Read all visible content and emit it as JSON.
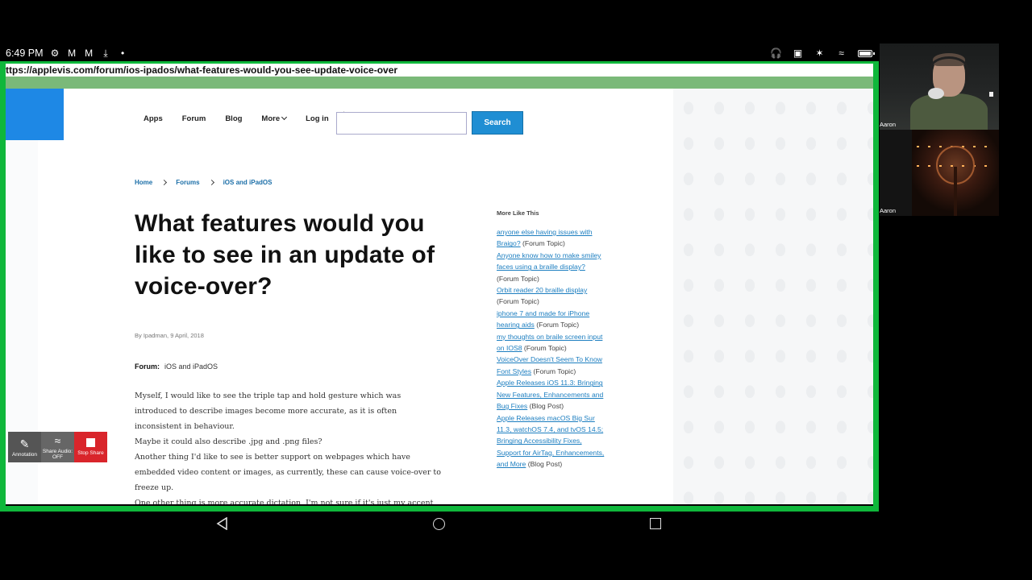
{
  "status_bar": {
    "time": "6:49 PM",
    "left_icons": [
      "gear-icon",
      "gmail-icon",
      "gmail-icon",
      "download-icon",
      "dot-icon"
    ],
    "right_icons": [
      "headphones-icon",
      "cast-icon",
      "bluetooth-icon",
      "wifi-icon",
      "battery-icon"
    ]
  },
  "browser": {
    "url": "ttps://applevis.com/forum/ios-ipados/what-features-would-you-see-update-voice-over"
  },
  "site_nav": {
    "items": [
      "Apps",
      "Forum",
      "Blog",
      "More",
      "Log in"
    ],
    "search_placeholder": "",
    "search_button": "Search"
  },
  "breadcrumb": [
    "Home",
    "Forums",
    "iOS and iPadOS"
  ],
  "article": {
    "title": "What features would you like to see in an update of voice-over?",
    "byline": "By Ipadman, 9 April, 2018",
    "forum_label": "Forum:",
    "forum_value": "iOS and iPadOS",
    "paragraphs": [
      "Myself, I would like to see the triple tap and hold gesture which was introduced to describe images become more accurate, as it is often inconsistent in behaviour.",
      "Maybe it could also describe .jpg and .png files?",
      "Another thing I'd like to see is better support on webpages which have embedded video content or images, as currently, these can cause voice-over to freeze up.",
      "One other thing is more accurate dictation, I'm not sure if it's just my accent but dictation doesn't seem to get most of my words right, or misses out some words entirely."
    ]
  },
  "sidebar": {
    "heading": "More Like This",
    "items": [
      {
        "link": "anyone else having issues with Braigo?",
        "type": "(Forum Topic)"
      },
      {
        "link": "Anyone know how to make smiley faces using a braille display?",
        "type": "(Forum Topic)"
      },
      {
        "link": "Orbit reader 20 braille display",
        "type": "(Forum Topic)"
      },
      {
        "link": "iphone 7 and made for iPhone hearing aids",
        "type": "(Forum Topic)"
      },
      {
        "link": "my thoughts on braile screen input on IOS8",
        "type": "(Forum Topic)"
      },
      {
        "link": "VoiceOver Doesn't Seem To Know Font Styles",
        "type": "(Forum Topic)"
      },
      {
        "link": "Apple Releases iOS 11.3: Bringing New Features, Enhancements and Bug Fixes",
        "type": "(Blog Post)"
      },
      {
        "link": "Apple Releases macOS Big Sur 11.3, watchOS 7.4, and tvOS 14.5; Bringing Accessibility Fixes, Support for AirTag, Enhancements, and More",
        "type": "(Blog Post)"
      }
    ]
  },
  "zoom_toolbar": {
    "annotation": "Annotation",
    "share_audio": "Share Audio:",
    "share_audio_state": "OFF",
    "stop_share": "Stop Share"
  },
  "participants": [
    {
      "name": "Aaron"
    },
    {
      "name": "Aaron"
    }
  ],
  "colors": {
    "share_border": "#0fb73b",
    "link": "#1c7ec0",
    "search_button": "#1f8ed3",
    "stop_share": "#d9252b"
  }
}
